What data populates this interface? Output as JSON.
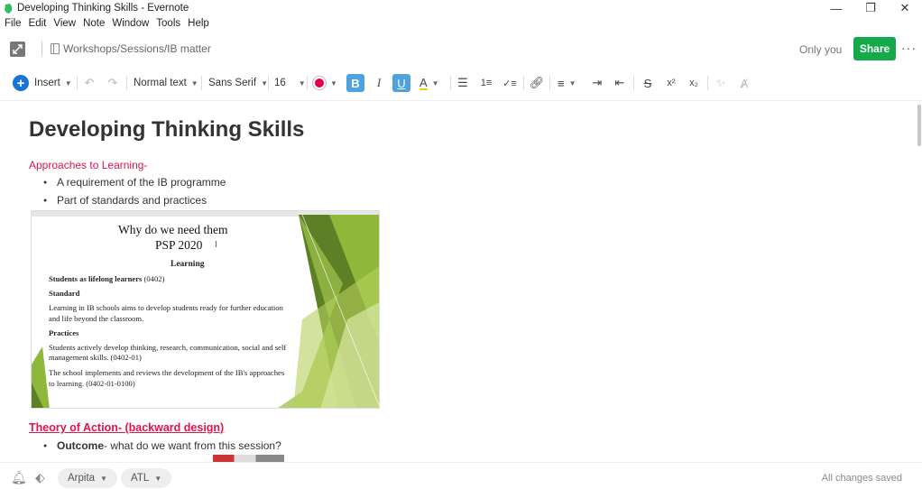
{
  "window": {
    "title": "Developing Thinking Skills - Evernote"
  },
  "menu": [
    "File",
    "Edit",
    "View",
    "Note",
    "Window",
    "Tools",
    "Help"
  ],
  "header": {
    "breadcrumb": "Workshops/Sessions/IB matter",
    "sharing": "Only you",
    "share_label": "Share",
    "more_label": "···"
  },
  "toolbar": {
    "insert_label": "Insert",
    "style_label": "Normal text",
    "font_label": "Sans Serif",
    "size_label": "16",
    "accent_color": "#e5004e"
  },
  "note": {
    "title": "Developing Thinking Skills",
    "section1": "Approaches to Learning-",
    "bullets1": [
      "A requirement of the IB programme",
      "Part of standards and practices"
    ],
    "section2": "Theory of Action- (backward design)",
    "bullet2_bold": "Outcome",
    "bullet2_rest": "- what do we want from this session?"
  },
  "slide": {
    "title": "Why do we need them",
    "subtitle": "PSP 2020",
    "heading": "Learning",
    "line1_bold": "Students as lifelong learners",
    "line1_rest": " (0402)",
    "standard_label": "Standard",
    "standard_text_1": " Learning in IB schools aims to develop students ready for further education",
    "standard_text_2": "and life beyond the classroom.",
    "practices_label": "Practices",
    "practices_1a": "Students actively develop thinking, research, communication, social and self",
    "practices_1b": "management skills. (0402-01)",
    "practices_2a": "The school implements and reviews the development of the IB's approaches",
    "practices_2b": "to learning. (0402-01-0100)"
  },
  "footer": {
    "tags": [
      "Arpita",
      "ATL"
    ],
    "status": "All changes saved"
  },
  "colors": {
    "share_green": "#14a94b",
    "accent_red": "#e0134b",
    "toolbar_active": "#4fa1e0",
    "insert_blue": "#1a74d6"
  }
}
